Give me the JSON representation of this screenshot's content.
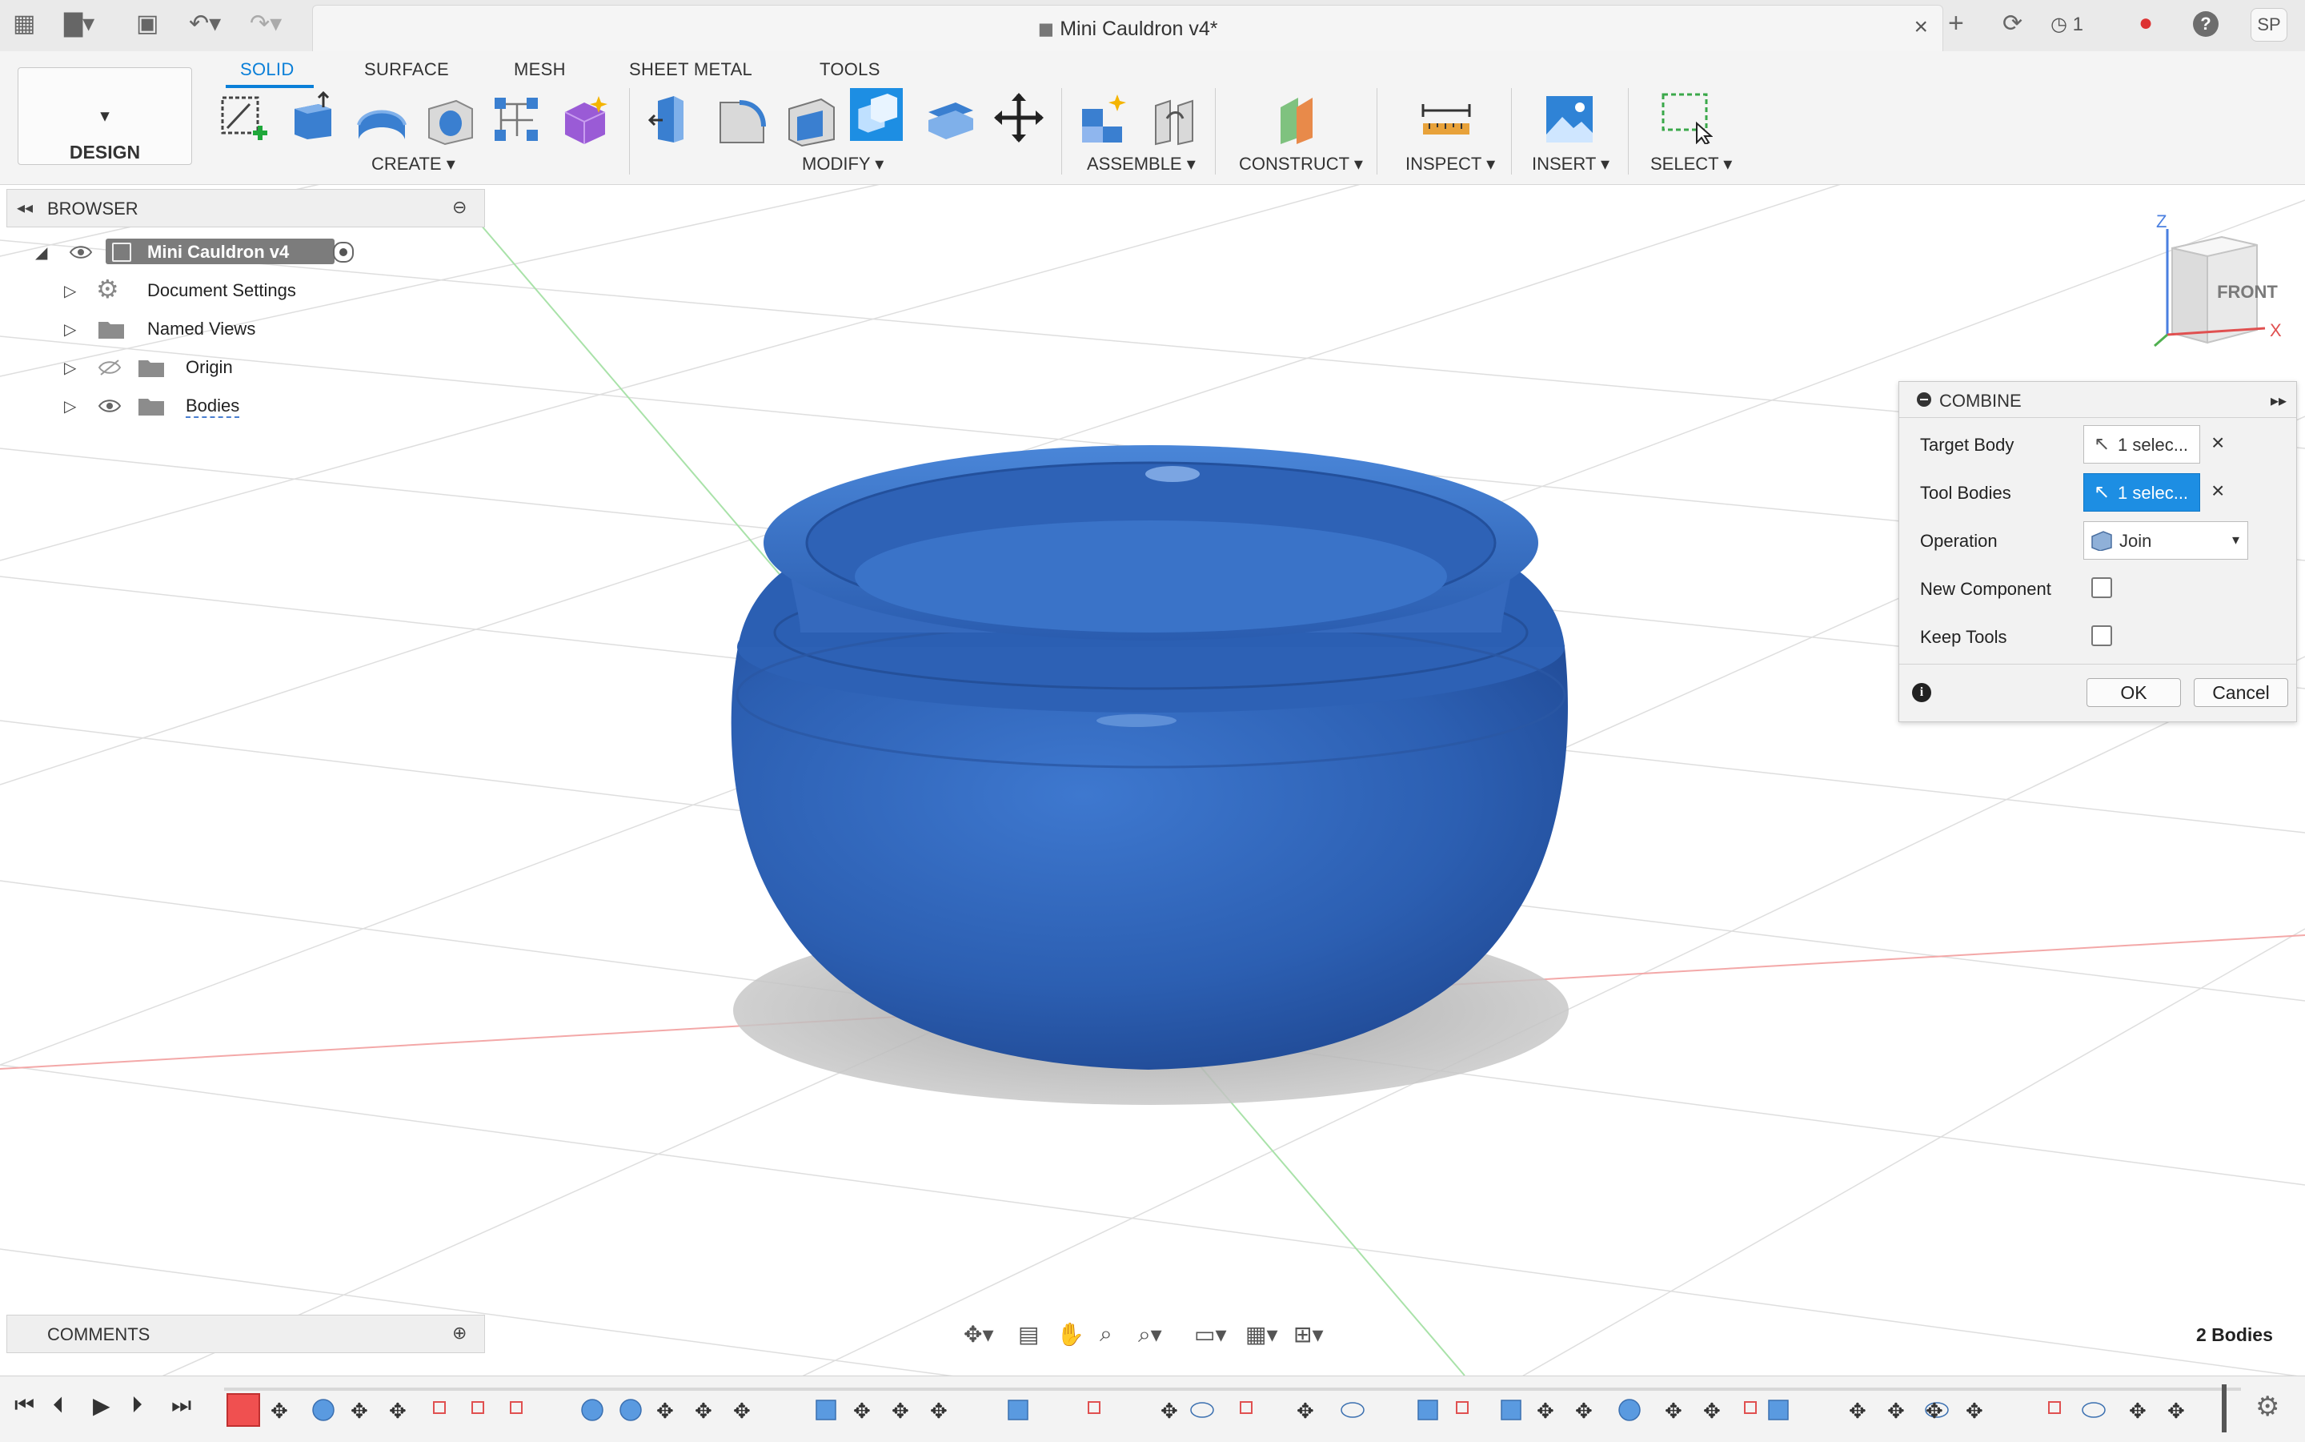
{
  "app": {
    "title": "Mini Cauldron v4*",
    "job_count": "1",
    "user_initials": "SP"
  },
  "ribbon": {
    "workspace": "DESIGN",
    "tabs": [
      "SOLID",
      "SURFACE",
      "MESH",
      "SHEET METAL",
      "TOOLS"
    ],
    "active_tab": "SOLID",
    "groups": [
      "CREATE",
      "MODIFY",
      "ASSEMBLE",
      "CONSTRUCT",
      "INSPECT",
      "INSERT",
      "SELECT"
    ]
  },
  "browser": {
    "title": "BROWSER",
    "root": "Mini Cauldron v4",
    "items": [
      "Document Settings",
      "Named Views",
      "Origin",
      "Bodies"
    ]
  },
  "viewcube": {
    "face": "FRONT",
    "axis_z": "Z",
    "axis_x": "X"
  },
  "combine": {
    "title": "COMBINE",
    "target_body_label": "Target Body",
    "target_body_value": "1 selec...",
    "tool_bodies_label": "Tool Bodies",
    "tool_bodies_value": "1 selec...",
    "operation_label": "Operation",
    "operation_value": "Join",
    "new_component_label": "New Component",
    "new_component_checked": false,
    "keep_tools_label": "Keep Tools",
    "keep_tools_checked": false,
    "ok_label": "OK",
    "cancel_label": "Cancel"
  },
  "comments": {
    "title": "COMMENTS"
  },
  "status": {
    "bodies_count": "2 Bodies"
  },
  "colors": {
    "accent": "#0a7fd8",
    "body": "#2f62b5",
    "selected": "#1d8ee3"
  }
}
